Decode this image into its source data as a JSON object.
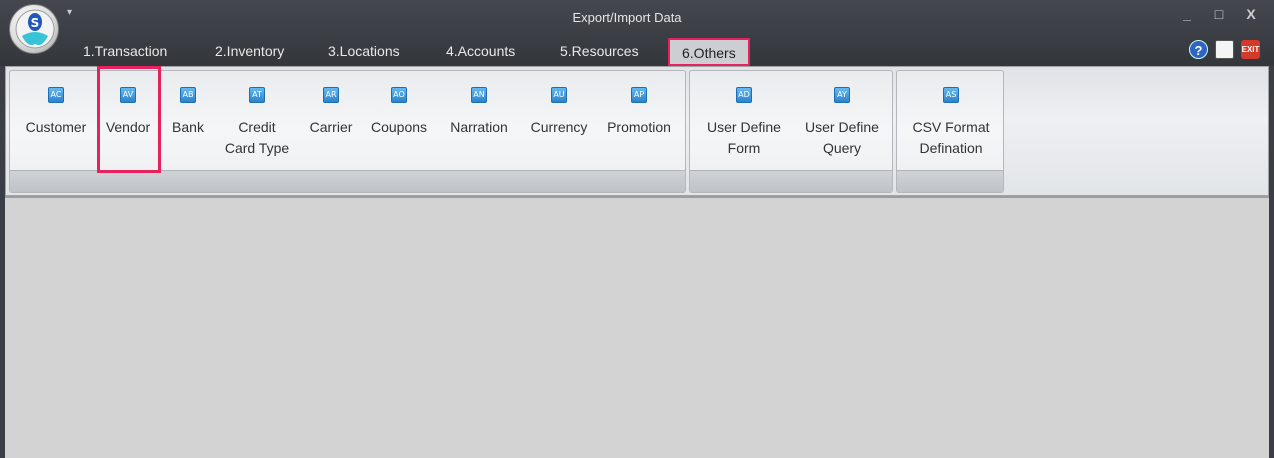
{
  "window": {
    "title": "Export/Import Data",
    "controls": [
      "_",
      "□",
      "X"
    ]
  },
  "tabs": [
    {
      "label": "1.Transaction"
    },
    {
      "label": "2.Inventory"
    },
    {
      "label": "3.Locations"
    },
    {
      "label": "4.Accounts"
    },
    {
      "label": "5.Resources"
    },
    {
      "label": "6.Others"
    }
  ],
  "active_tab": "6.Others",
  "ribbon": {
    "group1": [
      {
        "label": "Customer",
        "icon": "AC"
      },
      {
        "label": "Vendor",
        "icon": "AV"
      },
      {
        "label": "Bank",
        "icon": "AB"
      },
      {
        "label": "Credit\nCard Type",
        "icon": "AT"
      },
      {
        "label": "Carrier",
        "icon": "AR"
      },
      {
        "label": "Coupons",
        "icon": "AO"
      },
      {
        "label": "Narration",
        "icon": "AN"
      },
      {
        "label": "Currency",
        "icon": "AU"
      },
      {
        "label": "Promotion",
        "icon": "AP"
      }
    ],
    "group2": [
      {
        "label": "User Define\nForm",
        "icon": "AD"
      },
      {
        "label": "User Define\nQuery",
        "icon": "AY"
      }
    ],
    "group3": [
      {
        "label": "CSV Format\nDefination",
        "icon": "AS"
      }
    ]
  },
  "right_icons": {
    "help": "?",
    "exit": "EXIT"
  },
  "colors": {
    "highlight": "#e6225e",
    "titlebar": "#3b3f45",
    "content_bg": "#d3d3d3"
  }
}
